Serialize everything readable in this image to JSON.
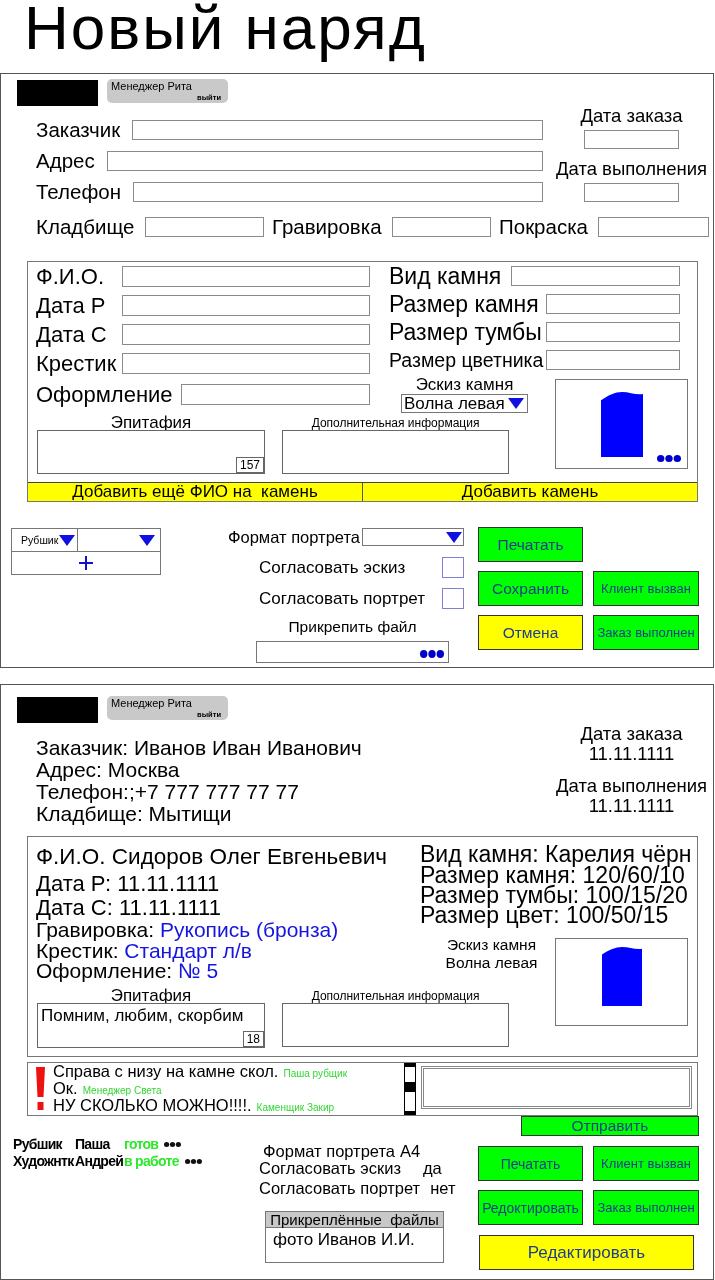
{
  "title": "Новый наряд",
  "edit_form": {
    "user": {
      "name": "Менеджер Рита",
      "logout": "выйти"
    },
    "customer_fields": [
      {
        "label": "Заказчик"
      },
      {
        "label": "Адрес"
      },
      {
        "label": "Телефон"
      }
    ],
    "date_fields": [
      {
        "label": "Дата заказа"
      },
      {
        "label": "Дата выполнения"
      }
    ],
    "extra_fields": [
      {
        "label": "Кладбище"
      },
      {
        "label": "Гравировка"
      },
      {
        "label": "Покраска"
      }
    ],
    "stone": {
      "left_fields": [
        {
          "label": "Ф.И.О."
        },
        {
          "label": "Дата Р"
        },
        {
          "label": "Дата С"
        },
        {
          "label": "Крестик"
        },
        {
          "label": "Оформление"
        }
      ],
      "right_fields": [
        {
          "label": "Вид камня"
        },
        {
          "label": "Размер камня"
        },
        {
          "label": "Размер тумбы"
        },
        {
          "label": "Размер цветника"
        }
      ],
      "sketch": {
        "label": "Эскиз камня",
        "value": "Волна левая"
      },
      "epitaph": {
        "label": "Эпитафия",
        "counter": "157"
      },
      "extra_info": {
        "label": "Дополнительная информация"
      },
      "actions": [
        "Добавить ещё ФИО на  камень",
        "Добавить камень"
      ]
    },
    "worker_picker": {
      "role": "Рубшик"
    },
    "portrait_format": {
      "label": "Формат портрета"
    },
    "approvals": [
      {
        "label": "Согласовать эскиз",
        "checked": false
      },
      {
        "label": "Согласовать портрет",
        "checked": false
      }
    ],
    "attachment": {
      "label": "Прикрепить файл"
    },
    "button_rows": [
      [
        {
          "label": "Печатать",
          "color": "#00ff00"
        }
      ],
      [
        {
          "label": "Сохранить",
          "color": "#00ff00"
        },
        {
          "label": "Клиент вызван",
          "color": "#00ff00"
        }
      ],
      [
        {
          "label": "Отмена",
          "color": "#ffff00"
        },
        {
          "label": "Заказ выполнен",
          "color": "#00ff00"
        }
      ]
    ]
  },
  "view_form": {
    "user": {
      "name": "Менеджер Рита",
      "logout": "выйти"
    },
    "customer_lines": [
      "Заказчик: Иванов Иван Иванович",
      "Адрес: Москва",
      "Телефон:;+7 777 777 77 77",
      "Кладбище: Мытищи"
    ],
    "dates": [
      {
        "label": "Дата заказа",
        "value": "11.11.1111"
      },
      {
        "label": "Дата выполнения",
        "value": "11.11.1111"
      }
    ],
    "stone": {
      "left_details": [
        {
          "label": "Ф.И.О.",
          "value": "Сидоров Олег Евгеньевич",
          "kind": "text"
        },
        {
          "label": "Дата Р:",
          "value": "11.11.1111",
          "kind": "text"
        },
        {
          "label": "Дата С:",
          "value": "11.11.1111",
          "kind": "text"
        },
        {
          "label": "Гравировка:",
          "value": "Рукопись (бронза)",
          "kind": "option"
        },
        {
          "label": "Крестик:",
          "value": "Стандарт л/в",
          "kind": "option"
        },
        {
          "label": "Оформление:",
          "value": "№ 5",
          "kind": "option"
        }
      ],
      "right_details": [
        "Вид камня: Карелия чёрн",
        "Размер камня: 120/60/10",
        "Размер тумбы: 100/15/20",
        "Размер цвет: 100/50/15"
      ],
      "sketch": {
        "label": "Эскиз камня",
        "value": "Волна левая"
      },
      "epitaph": {
        "label": "Эпитафия",
        "text": "Помним, любим, скорбим",
        "counter": "18"
      },
      "extra_info": {
        "label": "Дополнительная информация"
      }
    },
    "comments": [
      {
        "text": "Справа с низу на камне скол.",
        "author": "Паша рубщик"
      },
      {
        "text": "Ок.",
        "author": "Менеджер Света"
      },
      {
        "text": "НУ СКОЛЬКО МОЖНО!!!!.",
        "author": "Каменщик Закир"
      }
    ],
    "send": "Отправить",
    "workers": [
      {
        "role": "Рубшик",
        "name": "Паша",
        "status": "готов"
      },
      {
        "role": "Художнтк",
        "name": "Андрей",
        "status": "в работе"
      }
    ],
    "order_props": [
      {
        "label": "Формат портрета",
        "value": "А4"
      },
      {
        "label": "Согласовать эскиз",
        "value": "да"
      },
      {
        "label": "Согласовать портрет",
        "value": "нет"
      }
    ],
    "attachments": {
      "title": "Прикреплённые  файлы",
      "files": [
        "фото Иванов И.И."
      ]
    },
    "button_rows": [
      [
        {
          "label": "Печатать",
          "color": "#00ff00"
        },
        {
          "label": "Клиент вызван",
          "color": "#00ff00"
        }
      ],
      [
        {
          "label": "Редоктировать",
          "color": "#00ff00"
        },
        {
          "label": "Заказ выполнен",
          "color": "#00ff00"
        }
      ]
    ],
    "edit_button": {
      "label": "Редактировать",
      "color": "#ffff00"
    }
  }
}
